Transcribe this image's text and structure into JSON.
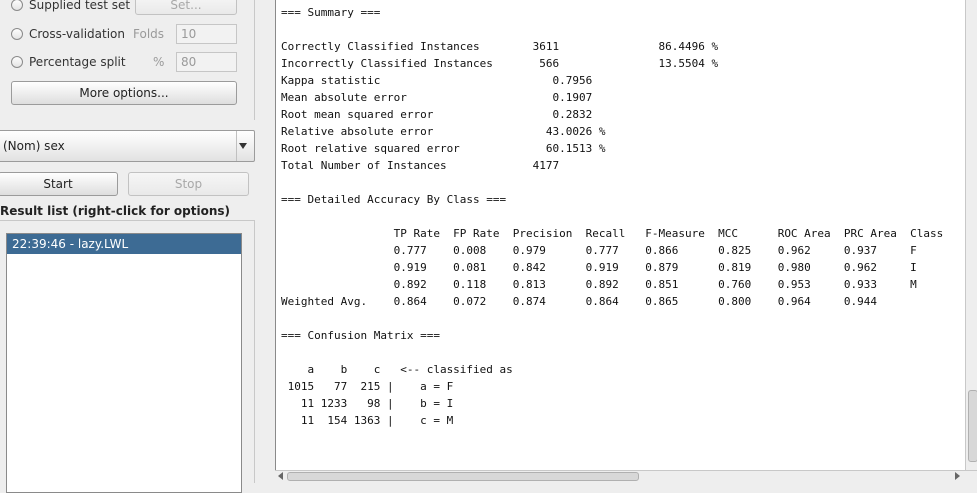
{
  "test_options": {
    "supplied_label": "Supplied test set",
    "set_button": "Set...",
    "cv_label": "Cross-validation",
    "folds_label": "Folds",
    "folds_value": "10",
    "split_label": "Percentage split",
    "pct_label": "%",
    "pct_value": "80",
    "more_options": "More options..."
  },
  "class_select": {
    "value": "(Nom) sex"
  },
  "controls": {
    "start": "Start",
    "stop": "Stop"
  },
  "result_list": {
    "label": "Result list (right-click for options)",
    "items": [
      "22:39:46 - lazy.LWL"
    ]
  },
  "output_text": "=== Summary ===\n\nCorrectly Classified Instances        3611               86.4496 %\nIncorrectly Classified Instances       566               13.5504 %\nKappa statistic                          0.7956\nMean absolute error                      0.1907\nRoot mean squared error                  0.2832\nRelative absolute error                 43.0026 %\nRoot relative squared error             60.1513 %\nTotal Number of Instances             4177     \n\n=== Detailed Accuracy By Class ===\n\n                 TP Rate  FP Rate  Precision  Recall   F-Measure  MCC      ROC Area  PRC Area  Class\n                 0.777    0.008    0.979      0.777    0.866      0.825    0.962     0.937     F\n                 0.919    0.081    0.842      0.919    0.879      0.819    0.980     0.962     I\n                 0.892    0.118    0.813      0.892    0.851      0.760    0.953     0.933     M\nWeighted Avg.    0.864    0.072    0.874      0.864    0.865      0.800    0.964     0.944     \n\n=== Confusion Matrix ===\n\n    a    b    c   <-- classified as\n 1015   77  215 |    a = F\n   11 1233   98 |    b = I\n   11  154 1363 |    c = M"
}
